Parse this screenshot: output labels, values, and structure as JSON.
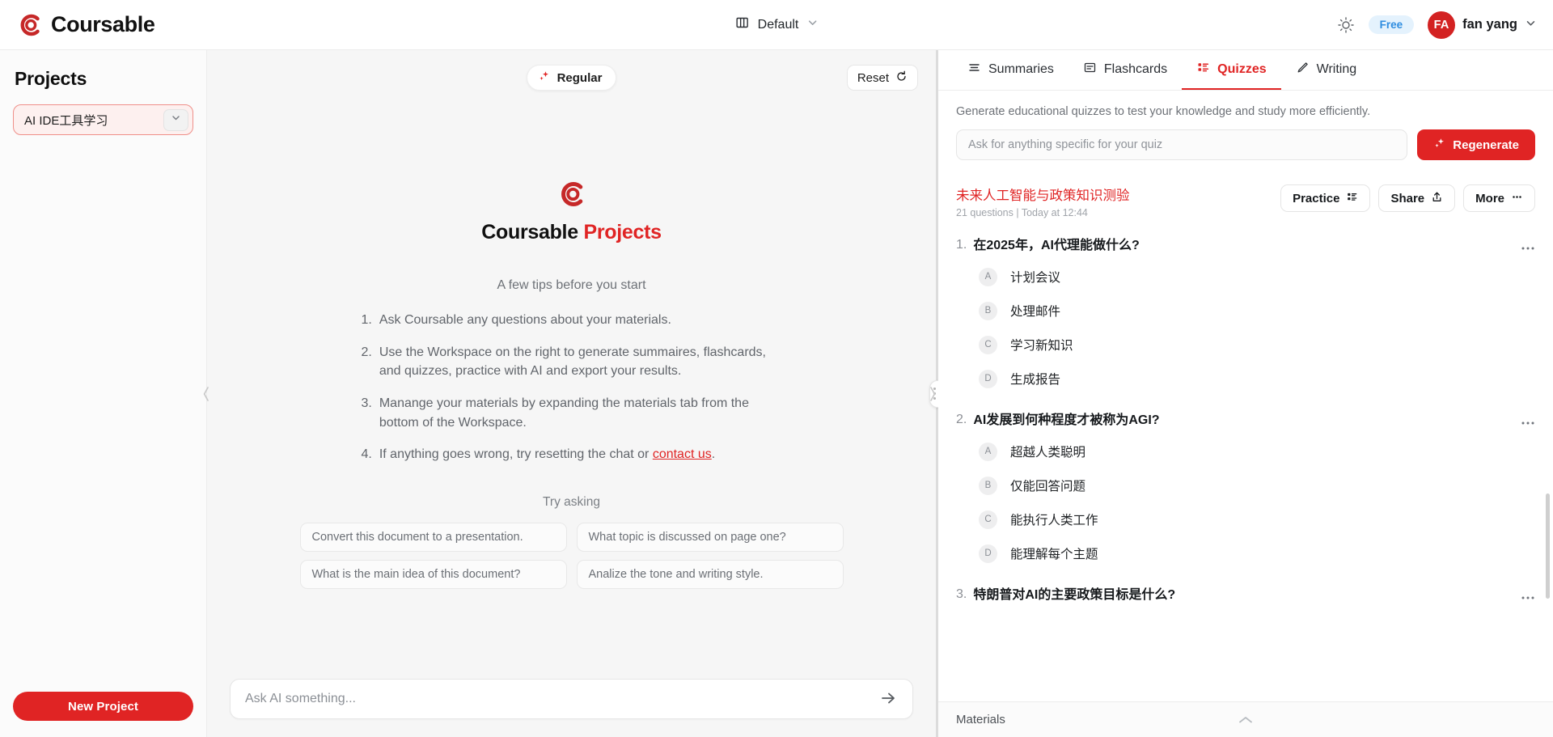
{
  "topbar": {
    "brand": "Coursable",
    "brand_icon": "coursable-logo-icon",
    "layout": {
      "icon": "columns-icon",
      "label": "Default",
      "chevron": "chevron-down-icon"
    },
    "theme_toggle_icon": "sun-icon",
    "plan_badge": "Free",
    "avatar_initials": "FA",
    "username": "fan yang",
    "user_chevron": "chevron-down-icon"
  },
  "sidebar": {
    "title": "Projects",
    "selected_project": "AI IDE工具学习",
    "project_chevron_icon": "chevron-down-icon",
    "new_project_label": "New Project",
    "collapse_icon": "chevron-left-icon"
  },
  "center": {
    "mode_pill": {
      "icon": "sparkles-icon",
      "label": "Regular"
    },
    "reset": {
      "label": "Reset",
      "icon": "rotate-ccw-icon"
    },
    "hero_icon": "coursable-logo-icon",
    "hero_title_primary": "Coursable",
    "hero_title_accent": "Projects",
    "tips_heading": "A few tips before you start",
    "tips": [
      {
        "num": "1.",
        "text": "Ask Coursable any questions about your materials."
      },
      {
        "num": "2.",
        "text": "Use the Workspace on the right to generate summaires, flashcards, and quizzes, practice with AI and export your results."
      },
      {
        "num": "3.",
        "text": "Manange your materials by expanding the materials tab from the bottom of the Workspace."
      },
      {
        "num": "4.",
        "text_before": "If anything goes wrong, try resetting the chat or ",
        "link": "contact us",
        "text_after": "."
      }
    ],
    "try_asking": "Try asking",
    "suggestions": [
      "Convert this document to a presentation.",
      "What topic is discussed on page one?",
      "What is the main idea of this document?",
      "Analize the tone and writing style."
    ],
    "composer_placeholder": "Ask AI something...",
    "composer_value": "",
    "send_icon": "send-arrow-icon",
    "expand_icon": "chevron-right-icon"
  },
  "workspace": {
    "tabs": [
      {
        "label": "Summaries",
        "icon": "lines-icon",
        "active": false
      },
      {
        "label": "Flashcards",
        "icon": "card-icon",
        "active": false
      },
      {
        "label": "Quizzes",
        "icon": "quiz-list-icon",
        "active": true
      },
      {
        "label": "Writing",
        "icon": "pencil-icon",
        "active": false
      }
    ],
    "description": "Generate educational quizzes to test your knowledge and study more efficiently.",
    "prompt_placeholder": "Ask for anything specific for your quiz",
    "prompt_value": "",
    "regenerate": {
      "label": "Regenerate",
      "icon": "sparkles-icon"
    },
    "quiz": {
      "title": "未来人工智能与政策知识测验",
      "meta": "21 questions | Today at 12:44",
      "actions": [
        {
          "label": "Practice",
          "icon": "quiz-list-icon"
        },
        {
          "label": "Share",
          "icon": "share-up-icon"
        },
        {
          "label": "More",
          "icon": "ellipsis-icon"
        }
      ],
      "questions": [
        {
          "num": "1.",
          "text": "在2025年，AI代理能做什么?",
          "options": [
            {
              "key": "A",
              "text": "计划会议"
            },
            {
              "key": "B",
              "text": "处理邮件"
            },
            {
              "key": "C",
              "text": "学习新知识"
            },
            {
              "key": "D",
              "text": "生成报告"
            }
          ]
        },
        {
          "num": "2.",
          "text": "AI发展到何种程度才被称为AGI?",
          "options": [
            {
              "key": "A",
              "text": "超越人类聪明"
            },
            {
              "key": "B",
              "text": "仅能回答问题"
            },
            {
              "key": "C",
              "text": "能执行人类工作"
            },
            {
              "key": "D",
              "text": "能理解每个主题"
            }
          ]
        },
        {
          "num": "3.",
          "text": "特朗普对AI的主要政策目标是什么?",
          "options": []
        }
      ]
    },
    "materials_label": "Materials",
    "materials_chevron_icon": "chevron-up-icon"
  },
  "colors": {
    "brand_red": "#e02424",
    "logo_red": "#c62828",
    "free_badge_bg": "#e4f2fd",
    "free_badge_text": "#2f8de0",
    "center_bg": "#f6f6f6"
  }
}
